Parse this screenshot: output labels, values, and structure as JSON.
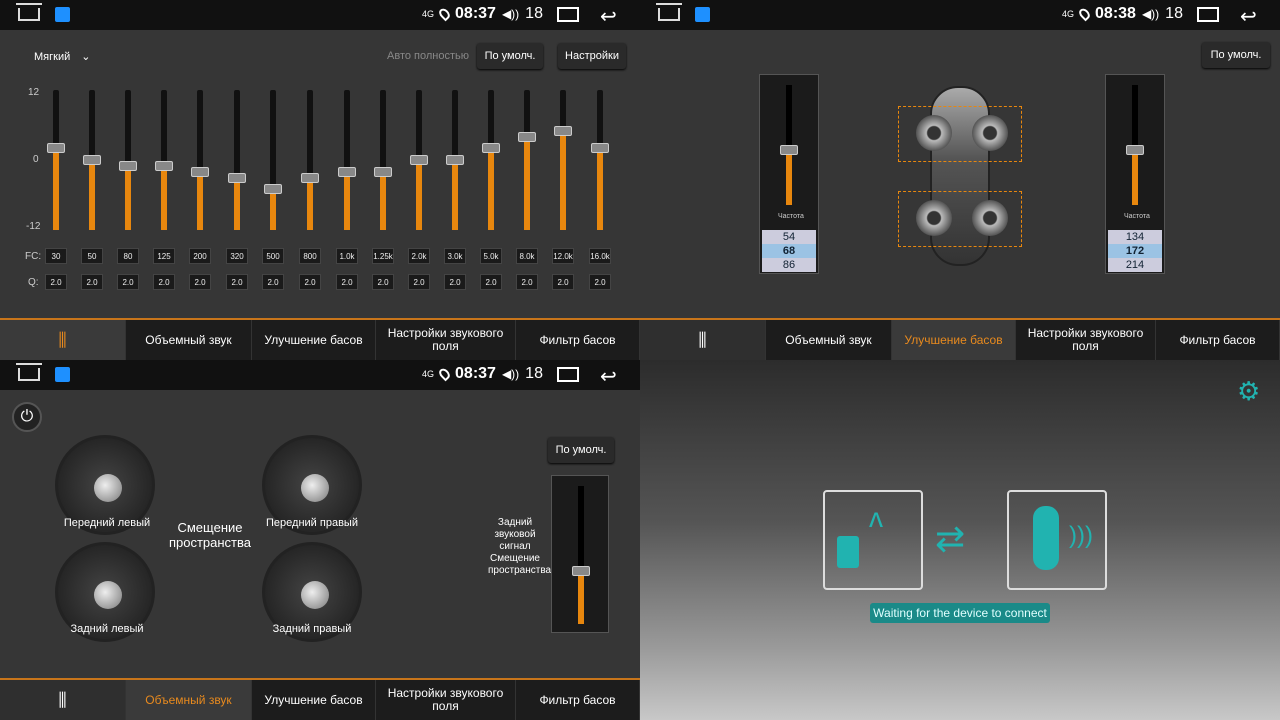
{
  "status": {
    "time1": "08:37",
    "time2": "08:38",
    "time3": "08:37",
    "vol": "18",
    "signal": "4G"
  },
  "eq": {
    "preset": "Мягкий",
    "auto": "Авто полностью",
    "default_btn": "По умолч.",
    "settings_btn": "Настройки",
    "y_top": "12",
    "y_mid": "0",
    "y_bot": "-12",
    "fc_label": "FC:",
    "q_label": "Q:",
    "fc": [
      "30",
      "50",
      "80",
      "125",
      "200",
      "320",
      "500",
      "800",
      "1.0k",
      "1.25k",
      "2.0k",
      "3.0k",
      "5.0k",
      "8.0k",
      "12.0k",
      "16.0k"
    ],
    "q": [
      "2.0",
      "2.0",
      "2.0",
      "2.0",
      "2.0",
      "2.0",
      "2.0",
      "2.0",
      "2.0",
      "2.0",
      "2.0",
      "2.0",
      "2.0",
      "2.0",
      "2.0",
      "2.0"
    ],
    "levels": [
      2,
      0,
      -1,
      -1,
      -2,
      -3,
      -5,
      -3,
      -2,
      -2,
      0,
      0,
      2,
      4,
      5,
      2
    ]
  },
  "tabs": {
    "t1": "Объемный звук",
    "t2": "Улучшение басов",
    "t3": "Настройки звукового поля",
    "t4": "Фильтр басов"
  },
  "bass": {
    "default_btn": "По умолч.",
    "freq_label": "Частота",
    "left": {
      "prev": "54",
      "val": "68",
      "next": "86"
    },
    "right": {
      "prev": "134",
      "val": "172",
      "next": "214"
    },
    "ticks": [
      "12",
      "9",
      "6",
      "3",
      "0"
    ]
  },
  "surround": {
    "default_btn": "По умолч.",
    "title": "Смещение пространства",
    "fl": "Передний левый",
    "fr": "Передний правый",
    "rl": "Задний левый",
    "rr": "Задний правый",
    "sub_label": "Задний звуковой сигнал Смещение пространства",
    "ticks": [
      "10",
      "5",
      "0",
      "-5",
      "-10"
    ]
  },
  "connect": {
    "status": "Waiting for the device to connect",
    "accent": "#21b3b0"
  }
}
